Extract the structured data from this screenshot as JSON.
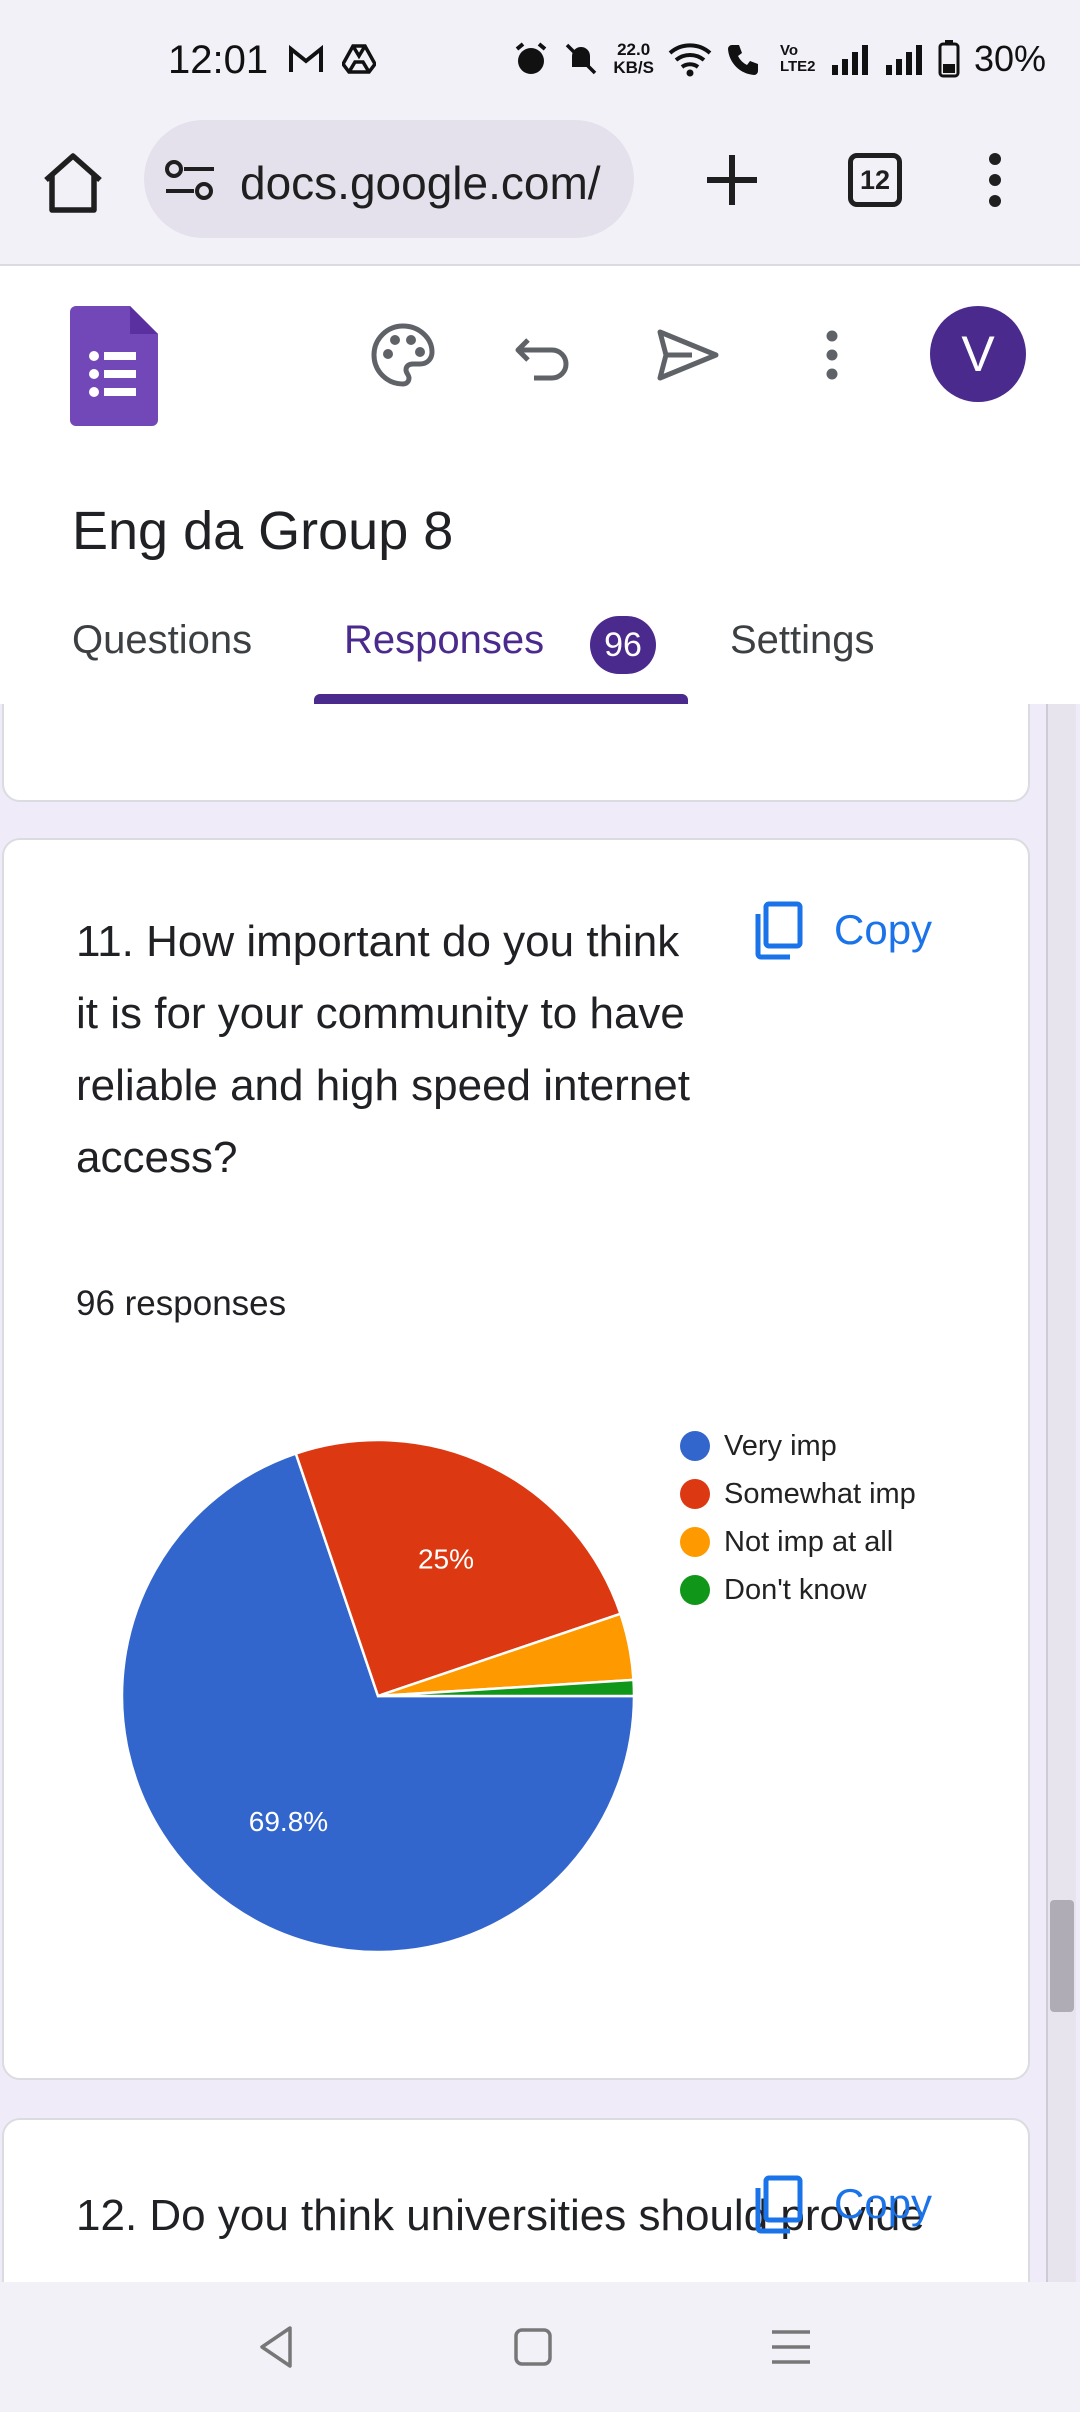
{
  "status_bar": {
    "time": "12:01",
    "net_speed_value": "22.0",
    "net_speed_unit": "KB/S",
    "volte": "Vo LTE2",
    "battery": "30%"
  },
  "browser": {
    "url": "docs.google.com/",
    "tab_count": "12"
  },
  "form": {
    "avatar_letter": "V",
    "title": "Eng da Group 8",
    "tabs": [
      {
        "label": "Questions"
      },
      {
        "label": "Responses",
        "badge": "96"
      },
      {
        "label": "Settings"
      }
    ],
    "brand_color": "#4b2a8d"
  },
  "question_11": {
    "text": "11. How important do you think it is for your community to have reliable and high speed internet access?",
    "copy_label": "Copy",
    "responses": "96 responses"
  },
  "question_12": {
    "text": "12. Do you think universities should provide",
    "copy_label": "Copy"
  },
  "chart_data": {
    "type": "pie",
    "labels": [
      "Very imp",
      "Somewhat imp",
      "Not imp at all",
      "Don't know"
    ],
    "values": [
      69.8,
      25,
      4.2,
      1
    ],
    "data_labels": [
      "69.8%",
      "25%",
      "",
      ""
    ],
    "colors": [
      "#3366cc",
      "#dc3912",
      "#ff9900",
      "#109618"
    ],
    "legend_position": "right"
  }
}
